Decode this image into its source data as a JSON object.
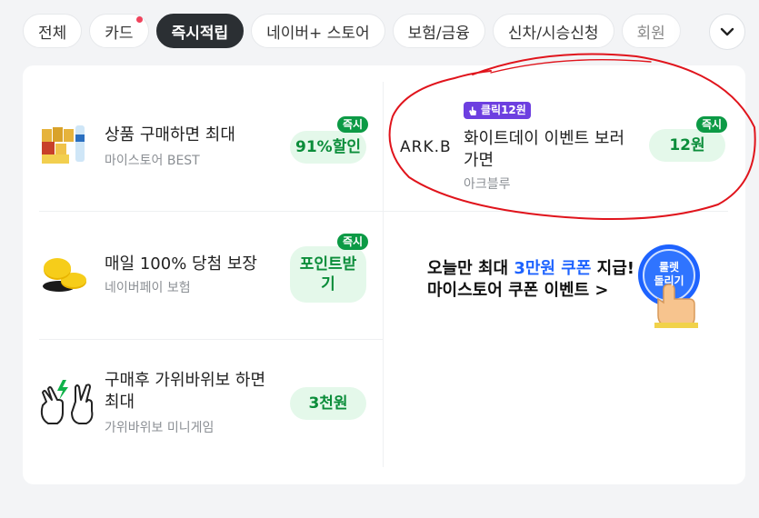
{
  "tabs": [
    {
      "label": "전체",
      "active": false,
      "dot": false
    },
    {
      "label": "카드",
      "active": false,
      "dot": true
    },
    {
      "label": "즉시적립",
      "active": true,
      "dot": false
    },
    {
      "label": "네이버+ 스토어",
      "active": false,
      "dot": false
    },
    {
      "label": "보험/금융",
      "active": false,
      "dot": false
    },
    {
      "label": "신차/시승신청",
      "active": false,
      "dot": false
    },
    {
      "label": "회원",
      "active": false,
      "dot": false
    }
  ],
  "items": {
    "product": {
      "title": "상품 구매하면 최대",
      "sub": "마이스토어 BEST",
      "reward": "91%할인",
      "instant": "즉시"
    },
    "whiteday": {
      "badge": "클릭12원",
      "brand": "ARK.B",
      "title1": "화이트데이 이벤트 보러",
      "title2": "가면",
      "sub": "아크블루",
      "reward": "12원",
      "instant": "즉시"
    },
    "daily": {
      "title": "매일 100% 당첨 보장",
      "sub": "네이버페이 보험",
      "reward1": "포인트받",
      "reward2": "기",
      "instant": "즉시"
    },
    "rps": {
      "title1": "구매후 가위바위보 하면",
      "title2": "최대",
      "sub": "가위바위보 미니게임",
      "reward": "3천원"
    }
  },
  "promo": {
    "line1_a": "오늘만 최대 ",
    "line1_hl": "3만원 쿠폰",
    "line1_b": " 지급!",
    "line2": "마이스토어 쿠폰 이벤트 >",
    "roulette1": "룰렛",
    "roulette2": "돌리기"
  },
  "colors": {
    "accent_green": "#0b8d3a",
    "active_tab": "#2b2f33",
    "promo_blue": "#1e63ff",
    "click_purple": "#6d3fe0",
    "annotation_red": "#e0141c"
  }
}
